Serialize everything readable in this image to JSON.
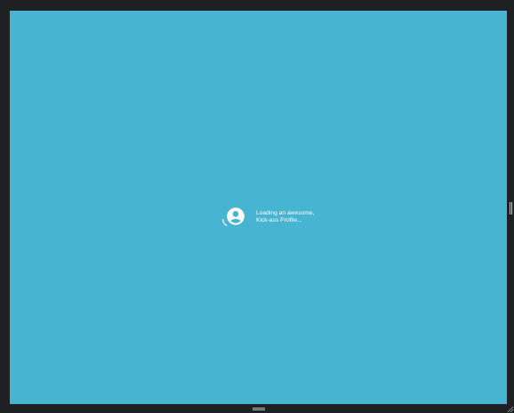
{
  "loading": {
    "message_line1": "Loading an awesome,",
    "message_line2": "Kick-ass Profile..."
  },
  "icons": {
    "profile": "account-circle-icon",
    "spinner": "loading-spinner-icon"
  },
  "colors": {
    "background": "#47b4d1",
    "frame": "#1f2023",
    "text": "#ffffff"
  }
}
